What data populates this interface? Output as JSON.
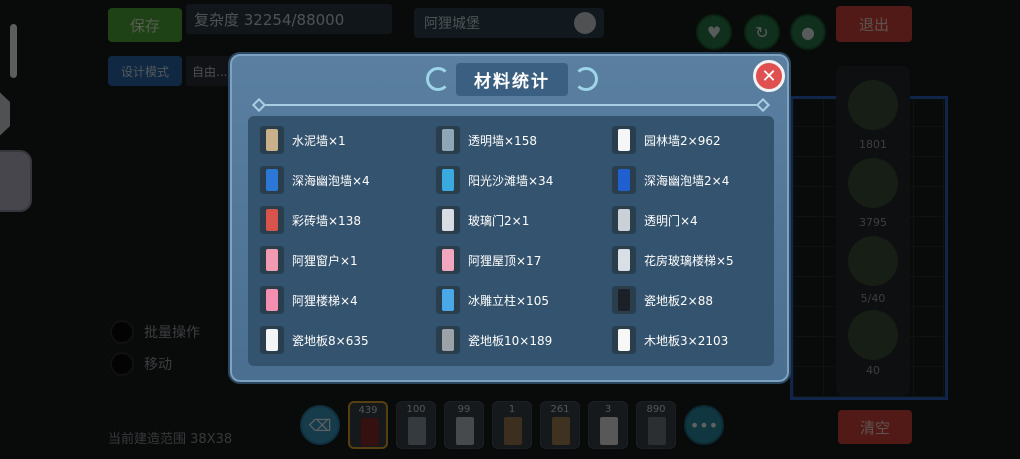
{
  "header": {
    "save_label": "保存",
    "complexity_text": "复杂度 32254/88000",
    "design_mode_label": "设计模式",
    "freedom_label": "自由...",
    "castle_name": "阿狸城堡",
    "exit_label": "退出"
  },
  "right_panel": {
    "counts": [
      "1801",
      "3795",
      "5/40",
      "40"
    ]
  },
  "left_options": [
    {
      "label": "批量操作"
    },
    {
      "label": "移动"
    }
  ],
  "build_range": "当前建造范围 38X38",
  "clear_label": "清空",
  "toolbar": {
    "slots": [
      {
        "count": "439",
        "color": "#8b2b2b",
        "selected": true
      },
      {
        "count": "100",
        "color": "#8d9aa4",
        "selected": false
      },
      {
        "count": "99",
        "color": "#b9c2c8",
        "selected": false
      },
      {
        "count": "1",
        "color": "#9d7d52",
        "selected": false
      },
      {
        "count": "261",
        "color": "#a88356",
        "selected": false
      },
      {
        "count": "3",
        "color": "#e6e6e6",
        "selected": false
      },
      {
        "count": "890",
        "color": "#727c84",
        "selected": false
      }
    ]
  },
  "modal": {
    "title": "材料统计",
    "close_icon": "close-icon",
    "items": [
      {
        "label": "水泥墙×1",
        "color": "#c9b18a"
      },
      {
        "label": "透明墙×158",
        "color": "#8ea6b6"
      },
      {
        "label": "园林墙2×962",
        "color": "#f4f6f7"
      },
      {
        "label": "深海幽泡墙×4",
        "color": "#2a77d8"
      },
      {
        "label": "阳光沙滩墙×34",
        "color": "#3aa9e0"
      },
      {
        "label": "深海幽泡墙2×4",
        "color": "#1f5fd0"
      },
      {
        "label": "彩砖墙×138",
        "color": "#d9534f"
      },
      {
        "label": "玻璃门2×1",
        "color": "#d7dde1"
      },
      {
        "label": "透明门×4",
        "color": "#c9d1d6"
      },
      {
        "label": "阿狸窗户×1",
        "color": "#f29ab2"
      },
      {
        "label": "阿狸屋顶×17",
        "color": "#f2a6c0"
      },
      {
        "label": "花房玻璃楼梯×5",
        "color": "#d9e0e5"
      },
      {
        "label": "阿狸楼梯×4",
        "color": "#f48fb1"
      },
      {
        "label": "冰雕立柱×105",
        "color": "#4aa8e6"
      },
      {
        "label": "瓷地板2×88",
        "color": "#1b2026"
      },
      {
        "label": "瓷地板8×635",
        "color": "#f3f4f5"
      },
      {
        "label": "瓷地板10×189",
        "color": "#9ba3a8"
      },
      {
        "label": "木地板3×2103",
        "color": "#f7f7f7"
      }
    ]
  }
}
